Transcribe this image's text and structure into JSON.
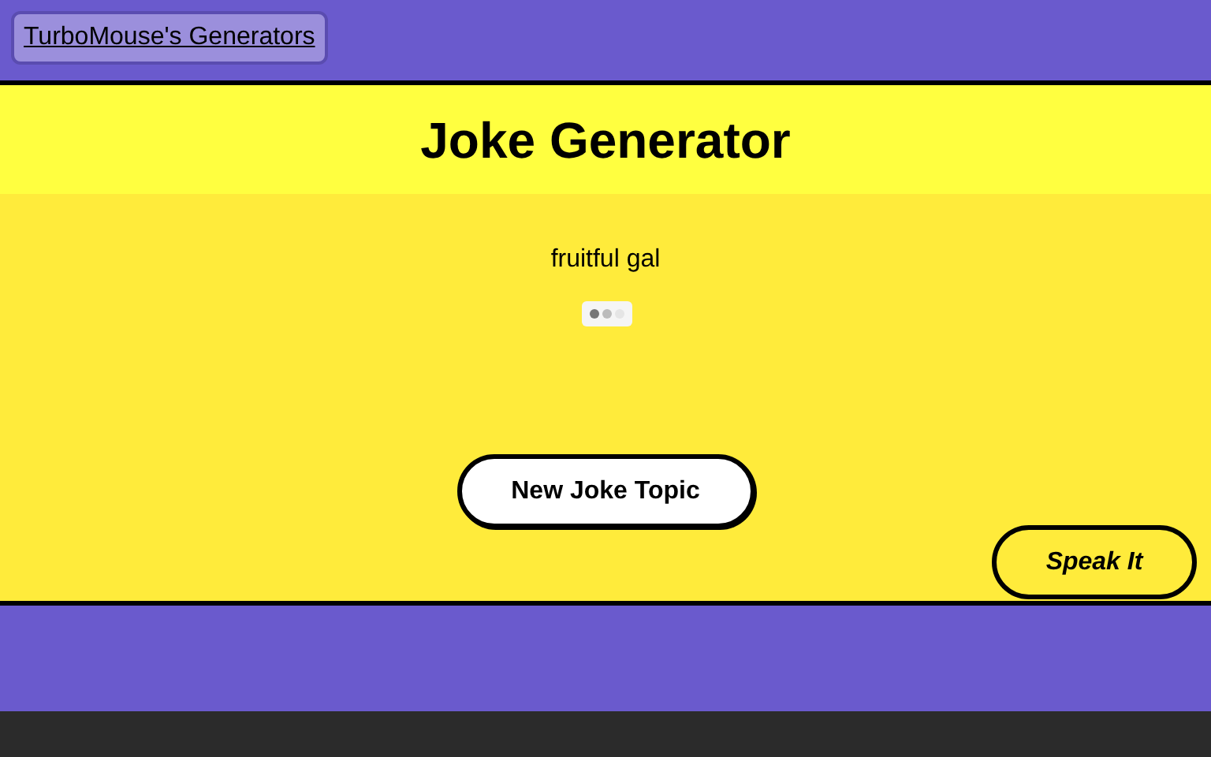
{
  "nav": {
    "link": "TurboMouse's Generators"
  },
  "header": {
    "title": "Joke Generator"
  },
  "joke": {
    "topic": "fruitful gal",
    "loading": true
  },
  "buttons": {
    "new_topic": "New Joke Topic",
    "speak": "Speak It"
  }
}
